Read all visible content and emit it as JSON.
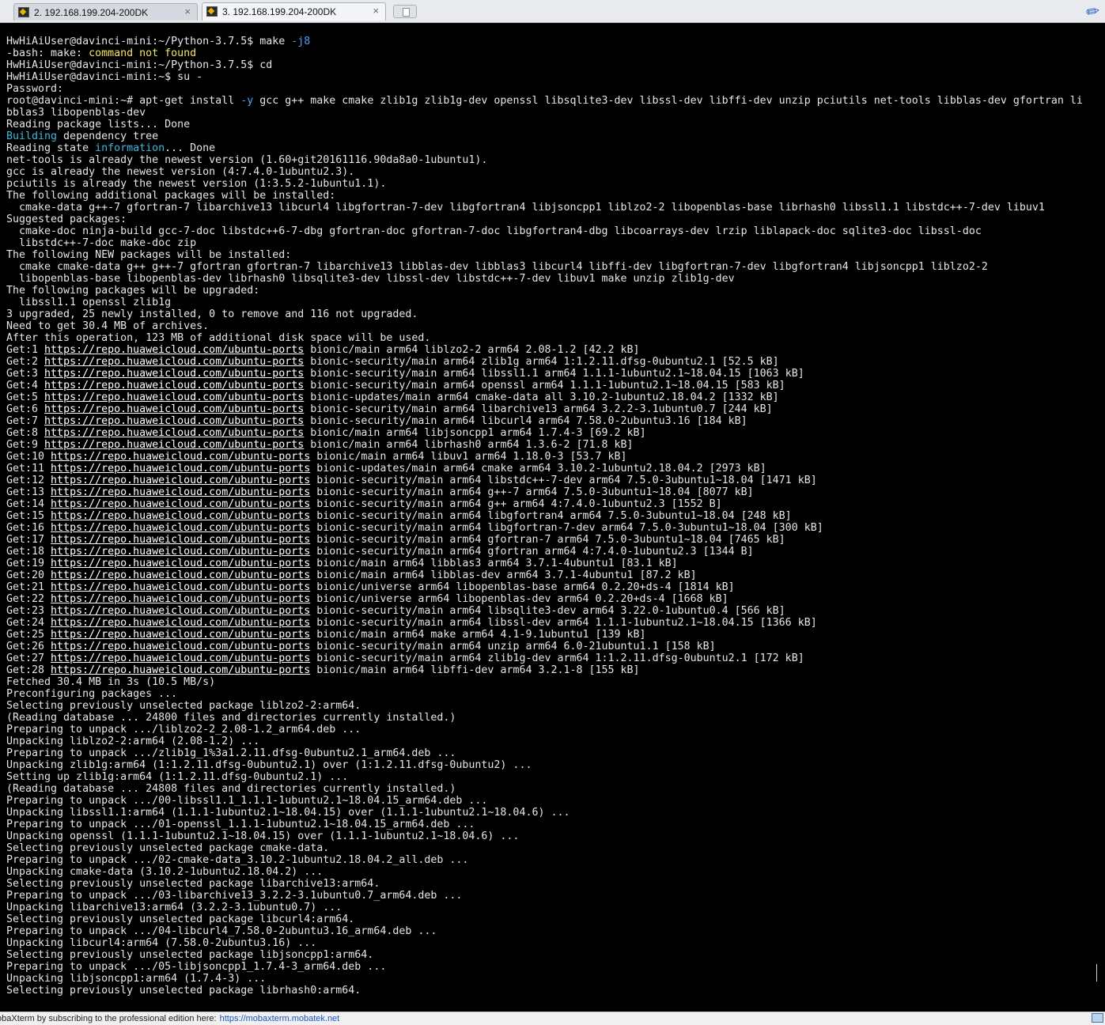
{
  "tabs": [
    {
      "label": "2. 192.168.199.204-200DK",
      "close": "×"
    },
    {
      "label": "3. 192.168.199.204-200DK",
      "close": "×"
    }
  ],
  "terminal": {
    "lines": [
      [
        {
          "t": "HwHiAiUser@davinci-mini:~/Python-3.7.5$ make "
        },
        {
          "t": "-j8",
          "c": "b"
        }
      ],
      [
        {
          "t": "-bash: make: "
        },
        {
          "t": "command not found",
          "c": "y"
        }
      ],
      [
        {
          "t": "HwHiAiUser@davinci-mini:~/Python-3.7.5$ cd"
        }
      ],
      [
        {
          "t": "HwHiAiUser@davinci-mini:~$ su -"
        }
      ],
      [
        {
          "t": "Password:"
        }
      ],
      [
        {
          "t": "root@davinci-mini:~# apt-get install "
        },
        {
          "t": "-y",
          "c": "b"
        },
        {
          "t": " gcc g++ make cmake zlib1g zlib1g-dev openssl libsqlite3-dev libssl-dev libffi-dev unzip pciutils net-tools libblas-dev gfortran li"
        }
      ],
      [
        {
          "t": "bblas3 libopenblas-dev"
        }
      ],
      [
        {
          "t": "Reading package lists... Done"
        }
      ],
      [
        {
          "t": "Building",
          "c": "c"
        },
        {
          "t": " dependency tree"
        }
      ],
      [
        {
          "t": "Reading state "
        },
        {
          "t": "information",
          "c": "c"
        },
        {
          "t": "... Done"
        }
      ],
      [
        {
          "t": "net-tools is already the newest version (1.60+git20161116.90da8a0-1ubuntu1)."
        }
      ],
      [
        {
          "t": "gcc is already the newest version (4:7.4.0-1ubuntu2.3)."
        }
      ],
      [
        {
          "t": "pciutils is already the newest version (1:3.5.2-1ubuntu1.1)."
        }
      ],
      [
        {
          "t": "The following additional packages will be installed:"
        }
      ],
      [
        {
          "t": "  cmake-data g++-7 gfortran-7 libarchive13 libcurl4 libgfortran-7-dev libgfortran4 libjsoncpp1 liblzo2-2 libopenblas-base librhash0 libssl1.1 libstdc++-7-dev libuv1"
        }
      ],
      [
        {
          "t": "Suggested packages:"
        }
      ],
      [
        {
          "t": "  cmake-doc ninja-build gcc-7-doc libstdc++6-7-dbg gfortran-doc gfortran-7-doc libgfortran4-dbg libcoarrays-dev lrzip liblapack-doc sqlite3-doc libssl-doc"
        }
      ],
      [
        {
          "t": "  libstdc++-7-doc make-doc zip"
        }
      ],
      [
        {
          "t": "The following NEW packages will be installed:"
        }
      ],
      [
        {
          "t": "  cmake cmake-data g++ g++-7 gfortran gfortran-7 libarchive13 libblas-dev libblas3 libcurl4 libffi-dev libgfortran-7-dev libgfortran4 libjsoncpp1 liblzo2-2"
        }
      ],
      [
        {
          "t": "  libopenblas-base libopenblas-dev librhash0 libsqlite3-dev libssl-dev libstdc++-7-dev libuv1 make unzip zlib1g-dev"
        }
      ],
      [
        {
          "t": "The following packages will be upgraded:"
        }
      ],
      [
        {
          "t": "  libssl1.1 openssl zlib1g"
        }
      ],
      [
        {
          "t": "3 upgraded, 25 newly installed, 0 to remove and 116 not upgraded."
        }
      ],
      [
        {
          "t": "Need to get 30.4 MB of archives."
        }
      ],
      [
        {
          "t": "After this operation, 123 MB of additional disk space will be used."
        }
      ],
      [
        {
          "t": "Get:1 "
        },
        {
          "t": "https://repo.huaweicloud.com/ubuntu-ports",
          "c": "u"
        },
        {
          "t": " bionic/main arm64 liblzo2-2 arm64 2.08-1.2 [42.2 kB]"
        }
      ],
      [
        {
          "t": "Get:2 "
        },
        {
          "t": "https://repo.huaweicloud.com/ubuntu-ports",
          "c": "u"
        },
        {
          "t": " bionic-security/main arm64 zlib1g arm64 1:1.2.11.dfsg-0ubuntu2.1 [52.5 kB]"
        }
      ],
      [
        {
          "t": "Get:3 "
        },
        {
          "t": "https://repo.huaweicloud.com/ubuntu-ports",
          "c": "u"
        },
        {
          "t": " bionic-security/main arm64 libssl1.1 arm64 1.1.1-1ubuntu2.1~18.04.15 [1063 kB]"
        }
      ],
      [
        {
          "t": "Get:4 "
        },
        {
          "t": "https://repo.huaweicloud.com/ubuntu-ports",
          "c": "u"
        },
        {
          "t": " bionic-security/main arm64 openssl arm64 1.1.1-1ubuntu2.1~18.04.15 [583 kB]"
        }
      ],
      [
        {
          "t": "Get:5 "
        },
        {
          "t": "https://repo.huaweicloud.com/ubuntu-ports",
          "c": "u"
        },
        {
          "t": " bionic-updates/main arm64 cmake-data all 3.10.2-1ubuntu2.18.04.2 [1332 kB]"
        }
      ],
      [
        {
          "t": "Get:6 "
        },
        {
          "t": "https://repo.huaweicloud.com/ubuntu-ports",
          "c": "u"
        },
        {
          "t": " bionic-security/main arm64 libarchive13 arm64 3.2.2-3.1ubuntu0.7 [244 kB]"
        }
      ],
      [
        {
          "t": "Get:7 "
        },
        {
          "t": "https://repo.huaweicloud.com/ubuntu-ports",
          "c": "u"
        },
        {
          "t": " bionic-security/main arm64 libcurl4 arm64 7.58.0-2ubuntu3.16 [184 kB]"
        }
      ],
      [
        {
          "t": "Get:8 "
        },
        {
          "t": "https://repo.huaweicloud.com/ubuntu-ports",
          "c": "u"
        },
        {
          "t": " bionic/main arm64 libjsoncpp1 arm64 1.7.4-3 [69.2 kB]"
        }
      ],
      [
        {
          "t": "Get:9 "
        },
        {
          "t": "https://repo.huaweicloud.com/ubuntu-ports",
          "c": "u"
        },
        {
          "t": " bionic/main arm64 librhash0 arm64 1.3.6-2 [71.8 kB]"
        }
      ],
      [
        {
          "t": "Get:10 "
        },
        {
          "t": "https://repo.huaweicloud.com/ubuntu-ports",
          "c": "u"
        },
        {
          "t": " bionic/main arm64 libuv1 arm64 1.18.0-3 [53.7 kB]"
        }
      ],
      [
        {
          "t": "Get:11 "
        },
        {
          "t": "https://repo.huaweicloud.com/ubuntu-ports",
          "c": "u"
        },
        {
          "t": " bionic-updates/main arm64 cmake arm64 3.10.2-1ubuntu2.18.04.2 [2973 kB]"
        }
      ],
      [
        {
          "t": "Get:12 "
        },
        {
          "t": "https://repo.huaweicloud.com/ubuntu-ports",
          "c": "u"
        },
        {
          "t": " bionic-security/main arm64 libstdc++-7-dev arm64 7.5.0-3ubuntu1~18.04 [1471 kB]"
        }
      ],
      [
        {
          "t": "Get:13 "
        },
        {
          "t": "https://repo.huaweicloud.com/ubuntu-ports",
          "c": "u"
        },
        {
          "t": " bionic-security/main arm64 g++-7 arm64 7.5.0-3ubuntu1~18.04 [8077 kB]"
        }
      ],
      [
        {
          "t": "Get:14 "
        },
        {
          "t": "https://repo.huaweicloud.com/ubuntu-ports",
          "c": "u"
        },
        {
          "t": " bionic-security/main arm64 g++ arm64 4:7.4.0-1ubuntu2.3 [1552 B]"
        }
      ],
      [
        {
          "t": "Get:15 "
        },
        {
          "t": "https://repo.huaweicloud.com/ubuntu-ports",
          "c": "u"
        },
        {
          "t": " bionic-security/main arm64 libgfortran4 arm64 7.5.0-3ubuntu1~18.04 [248 kB]"
        }
      ],
      [
        {
          "t": "Get:16 "
        },
        {
          "t": "https://repo.huaweicloud.com/ubuntu-ports",
          "c": "u"
        },
        {
          "t": " bionic-security/main arm64 libgfortran-7-dev arm64 7.5.0-3ubuntu1~18.04 [300 kB]"
        }
      ],
      [
        {
          "t": "Get:17 "
        },
        {
          "t": "https://repo.huaweicloud.com/ubuntu-ports",
          "c": "u"
        },
        {
          "t": " bionic-security/main arm64 gfortran-7 arm64 7.5.0-3ubuntu1~18.04 [7465 kB]"
        }
      ],
      [
        {
          "t": "Get:18 "
        },
        {
          "t": "https://repo.huaweicloud.com/ubuntu-ports",
          "c": "u"
        },
        {
          "t": " bionic-security/main arm64 gfortran arm64 4:7.4.0-1ubuntu2.3 [1344 B]"
        }
      ],
      [
        {
          "t": "Get:19 "
        },
        {
          "t": "https://repo.huaweicloud.com/ubuntu-ports",
          "c": "u"
        },
        {
          "t": " bionic/main arm64 libblas3 arm64 3.7.1-4ubuntu1 [83.1 kB]"
        }
      ],
      [
        {
          "t": "Get:20 "
        },
        {
          "t": "https://repo.huaweicloud.com/ubuntu-ports",
          "c": "u"
        },
        {
          "t": " bionic/main arm64 libblas-dev arm64 3.7.1-4ubuntu1 [87.2 kB]"
        }
      ],
      [
        {
          "t": "Get:21 "
        },
        {
          "t": "https://repo.huaweicloud.com/ubuntu-ports",
          "c": "u"
        },
        {
          "t": " bionic/universe arm64 libopenblas-base arm64 0.2.20+ds-4 [1814 kB]"
        }
      ],
      [
        {
          "t": "Get:22 "
        },
        {
          "t": "https://repo.huaweicloud.com/ubuntu-ports",
          "c": "u"
        },
        {
          "t": " bionic/universe arm64 libopenblas-dev arm64 0.2.20+ds-4 [1668 kB]"
        }
      ],
      [
        {
          "t": "Get:23 "
        },
        {
          "t": "https://repo.huaweicloud.com/ubuntu-ports",
          "c": "u"
        },
        {
          "t": " bionic-security/main arm64 libsqlite3-dev arm64 3.22.0-1ubuntu0.4 [566 kB]"
        }
      ],
      [
        {
          "t": "Get:24 "
        },
        {
          "t": "https://repo.huaweicloud.com/ubuntu-ports",
          "c": "u"
        },
        {
          "t": " bionic-security/main arm64 libssl-dev arm64 1.1.1-1ubuntu2.1~18.04.15 [1366 kB]"
        }
      ],
      [
        {
          "t": "Get:25 "
        },
        {
          "t": "https://repo.huaweicloud.com/ubuntu-ports",
          "c": "u"
        },
        {
          "t": " bionic/main arm64 make arm64 4.1-9.1ubuntu1 [139 kB]"
        }
      ],
      [
        {
          "t": "Get:26 "
        },
        {
          "t": "https://repo.huaweicloud.com/ubuntu-ports",
          "c": "u"
        },
        {
          "t": " bionic-security/main arm64 unzip arm64 6.0-21ubuntu1.1 [158 kB]"
        }
      ],
      [
        {
          "t": "Get:27 "
        },
        {
          "t": "https://repo.huaweicloud.com/ubuntu-ports",
          "c": "u"
        },
        {
          "t": " bionic-security/main arm64 zlib1g-dev arm64 1:1.2.11.dfsg-0ubuntu2.1 [172 kB]"
        }
      ],
      [
        {
          "t": "Get:28 "
        },
        {
          "t": "https://repo.huaweicloud.com/ubuntu-ports",
          "c": "u"
        },
        {
          "t": " bionic/main arm64 libffi-dev arm64 3.2.1-8 [155 kB]"
        }
      ],
      [
        {
          "t": "Fetched 30.4 MB in 3s (10.5 MB/s)"
        }
      ],
      [
        {
          "t": "Preconfiguring packages ..."
        }
      ],
      [
        {
          "t": "Selecting previously unselected package liblzo2-2:arm64."
        }
      ],
      [
        {
          "t": "(Reading database ... 24800 files and directories currently installed.)"
        }
      ],
      [
        {
          "t": "Preparing to unpack .../liblzo2-2_2.08-1.2_arm64.deb ..."
        }
      ],
      [
        {
          "t": "Unpacking liblzo2-2:arm64 (2.08-1.2) ..."
        }
      ],
      [
        {
          "t": "Preparing to unpack .../zlib1g_1%3a1.2.11.dfsg-0ubuntu2.1_arm64.deb ..."
        }
      ],
      [
        {
          "t": "Unpacking zlib1g:arm64 (1:1.2.11.dfsg-0ubuntu2.1) over (1:1.2.11.dfsg-0ubuntu2) ..."
        }
      ],
      [
        {
          "t": "Setting up zlib1g:arm64 (1:1.2.11.dfsg-0ubuntu2.1) ..."
        }
      ],
      [
        {
          "t": "(Reading database ... 24808 files and directories currently installed.)"
        }
      ],
      [
        {
          "t": "Preparing to unpack .../00-libssl1.1_1.1.1-1ubuntu2.1~18.04.15_arm64.deb ..."
        }
      ],
      [
        {
          "t": "Unpacking libssl1.1:arm64 (1.1.1-1ubuntu2.1~18.04.15) over (1.1.1-1ubuntu2.1~18.04.6) ..."
        }
      ],
      [
        {
          "t": "Preparing to unpack .../01-openssl_1.1.1-1ubuntu2.1~18.04.15_arm64.deb ..."
        }
      ],
      [
        {
          "t": "Unpacking openssl (1.1.1-1ubuntu2.1~18.04.15) over (1.1.1-1ubuntu2.1~18.04.6) ..."
        }
      ],
      [
        {
          "t": "Selecting previously unselected package cmake-data."
        }
      ],
      [
        {
          "t": "Preparing to unpack .../02-cmake-data_3.10.2-1ubuntu2.18.04.2_all.deb ..."
        }
      ],
      [
        {
          "t": "Unpacking cmake-data (3.10.2-1ubuntu2.18.04.2) ..."
        }
      ],
      [
        {
          "t": "Selecting previously unselected package libarchive13:arm64."
        }
      ],
      [
        {
          "t": "Preparing to unpack .../03-libarchive13_3.2.2-3.1ubuntu0.7_arm64.deb ..."
        }
      ],
      [
        {
          "t": "Unpacking libarchive13:arm64 (3.2.2-3.1ubuntu0.7) ..."
        }
      ],
      [
        {
          "t": "Selecting previously unselected package libcurl4:arm64."
        }
      ],
      [
        {
          "t": "Preparing to unpack .../04-libcurl4_7.58.0-2ubuntu3.16_arm64.deb ..."
        }
      ],
      [
        {
          "t": "Unpacking libcurl4:arm64 (7.58.0-2ubuntu3.16) ..."
        }
      ],
      [
        {
          "t": "Selecting previously unselected package libjsoncpp1:arm64."
        }
      ],
      [
        {
          "t": "Preparing to unpack .../05-libjsoncpp1_1.7.4-3_arm64.deb ..."
        }
      ],
      [
        {
          "t": "Unpacking libjsoncpp1:arm64 (1.7.4-3) ..."
        }
      ],
      [
        {
          "t": "Selecting previously unselected package librhash0:arm64."
        }
      ]
    ]
  },
  "statusbar": {
    "text": "obaXterm by subscribing to the professional edition here:",
    "link": "https://mobaxterm.mobatek.net"
  },
  "colors": {
    "terminal_bg": "#000000",
    "text": "#e6e6e6",
    "yellow": "#f5e55a",
    "blue": "#4da3ff",
    "cyan": "#3fb6d9"
  },
  "icons": [
    "terminal-tab-icon",
    "new-tab-icon",
    "attachment-clip-icon",
    "monitor-icon"
  ]
}
